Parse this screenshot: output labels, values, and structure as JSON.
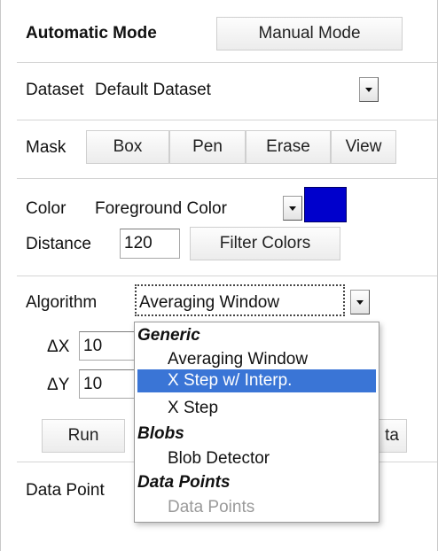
{
  "mode": {
    "automatic_label": "Automatic Mode",
    "manual_label": "Manual Mode"
  },
  "dataset": {
    "label": "Dataset",
    "selected": "Default Dataset"
  },
  "mask": {
    "label": "Mask",
    "buttons": [
      "Box",
      "Pen",
      "Erase",
      "View"
    ]
  },
  "color": {
    "label": "Color",
    "selected": "Foreground Color",
    "swatch": "#0000cc"
  },
  "distance": {
    "label": "Distance",
    "value": "120",
    "filter_label": "Filter Colors"
  },
  "algorithm": {
    "label": "Algorithm",
    "selected": "Averaging Window"
  },
  "params": {
    "dx_label": "ΔX",
    "dx_value": "10",
    "dy_label": "ΔY",
    "dy_value": "10"
  },
  "run_label": "Run",
  "partial_button_label": "ta",
  "data_points_label": "Data Point",
  "dropdown": {
    "groups": [
      {
        "label": "Generic",
        "options": [
          "Averaging Window",
          "X Step w/ Interp.",
          "X Step"
        ]
      },
      {
        "label": "Blobs",
        "options": [
          "Blob Detector"
        ]
      },
      {
        "label": "Data Points",
        "options": [
          "Data Points"
        ]
      }
    ],
    "highlighted": "X Step w/ Interp.",
    "disabled": "Data Points",
    "highlight_color": "#3a75d6"
  }
}
